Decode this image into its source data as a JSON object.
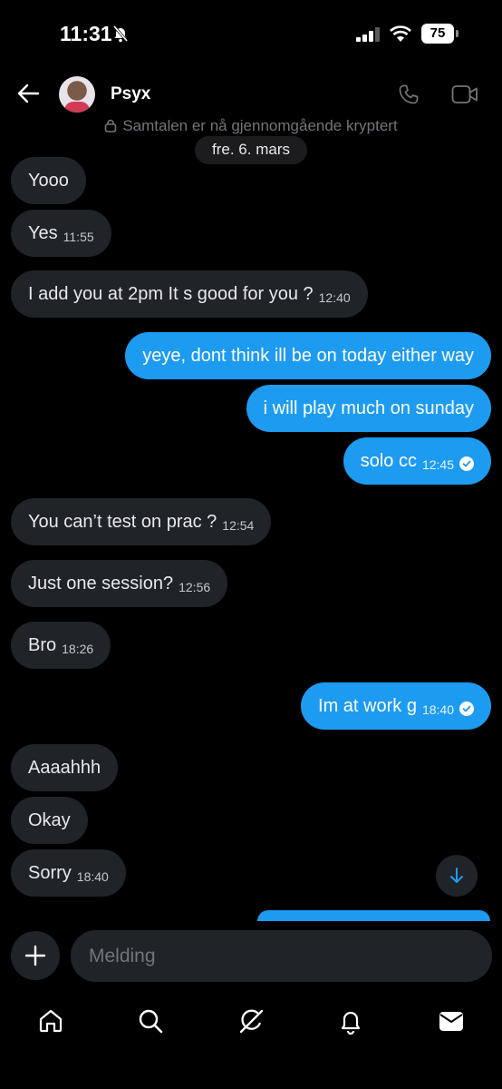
{
  "status_bar": {
    "time": "11:31",
    "battery": "75"
  },
  "header": {
    "contact_name": "Psyx",
    "encryption_notice": "Samtalen er nå gjennomgående kryptert",
    "date_chip": "fre. 6. mars"
  },
  "messages": [
    {
      "dir": "in",
      "text": "Yooo",
      "time": ""
    },
    {
      "dir": "in",
      "text": "Yes",
      "time": "11:55"
    },
    {
      "dir": "in",
      "text": "I add you at 2pm It s good for you ?",
      "time": "12:40"
    },
    {
      "dir": "out",
      "text": "yeye, dont think ill be on today either way",
      "time": ""
    },
    {
      "dir": "out",
      "text": "i will play much on sunday",
      "time": ""
    },
    {
      "dir": "out",
      "text": "solo cc",
      "time": "12:45",
      "read": true
    },
    {
      "dir": "in",
      "text": "You can’t test on prac ?",
      "time": "12:54"
    },
    {
      "dir": "in",
      "text": "Just one session?",
      "time": "12:56"
    },
    {
      "dir": "in",
      "text": "Bro",
      "time": "18:26"
    },
    {
      "dir": "out",
      "text": "Im at work g",
      "time": "18:40",
      "read": true
    },
    {
      "dir": "in",
      "text": "Aaaahhh",
      "time": ""
    },
    {
      "dir": "in",
      "text": "Okay",
      "time": ""
    },
    {
      "dir": "in",
      "text": "Sorry",
      "time": "18:40"
    }
  ],
  "composer": {
    "placeholder": "Melding"
  },
  "icons": {
    "header": [
      "back-arrow-icon",
      "phone-icon",
      "video-camera-icon",
      "lock-icon"
    ],
    "tabs": [
      "home-icon",
      "search-icon",
      "grok-icon",
      "notifications-icon",
      "messages-icon"
    ]
  },
  "colors": {
    "outgoing": "#1d9bf0",
    "incoming": "#202327",
    "background": "#000000"
  }
}
